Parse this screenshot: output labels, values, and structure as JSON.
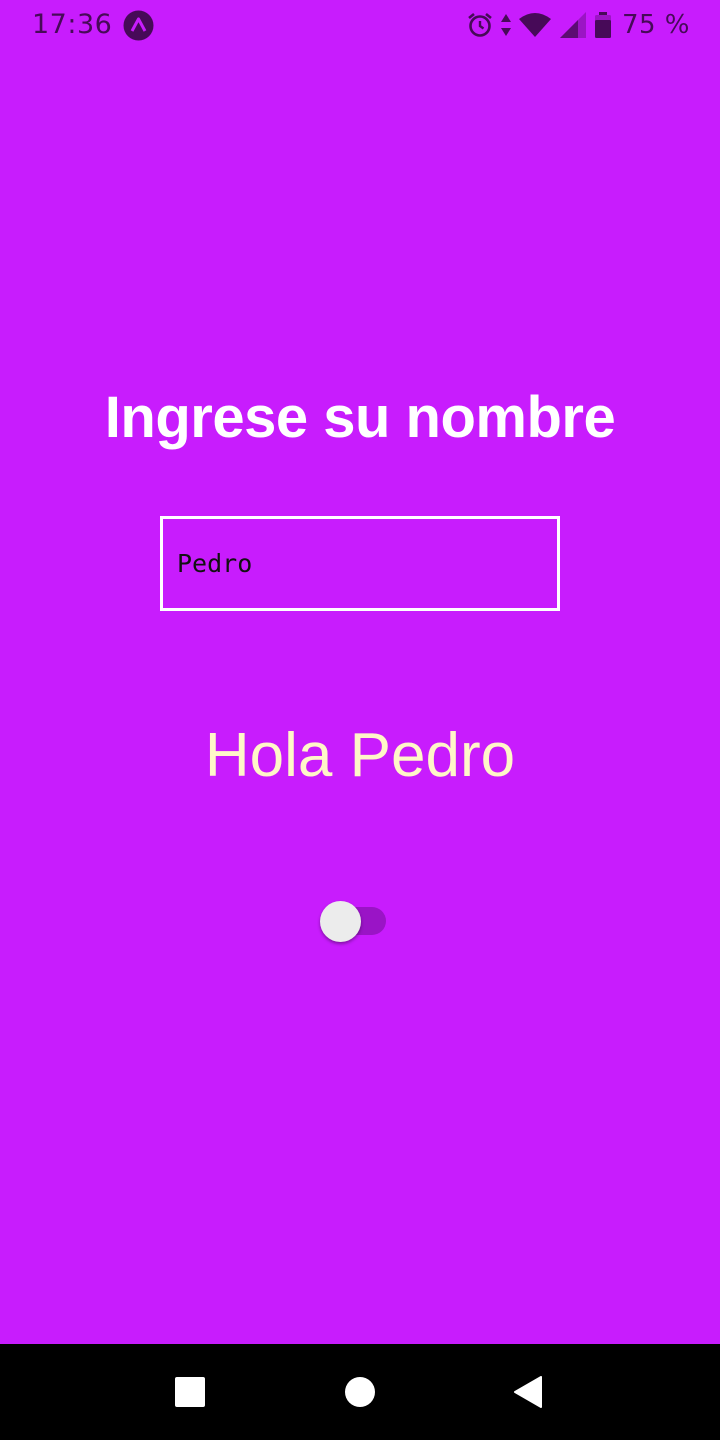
{
  "status_bar": {
    "time": "17:36",
    "battery_percent": "75 %",
    "icons": [
      "app-notification-icon",
      "alarm-icon",
      "data-transfer-icon",
      "wifi-icon",
      "cell-signal-icon",
      "battery-icon"
    ]
  },
  "main": {
    "title": "Ingrese su nombre",
    "name_input": {
      "value": "Pedro",
      "placeholder": ""
    },
    "greeting": "Hola Pedro",
    "toggle": {
      "on": false
    }
  },
  "nav_bar": {
    "buttons": [
      "recents-button",
      "home-button",
      "back-button"
    ]
  },
  "colors": {
    "background": "#c81cfd",
    "title": "#ffffff",
    "greeting": "#fff7c8",
    "input_border": "#ffffff",
    "toggle_track": "#9a14c6",
    "toggle_thumb": "#ececec",
    "nav_bar": "#000000"
  }
}
